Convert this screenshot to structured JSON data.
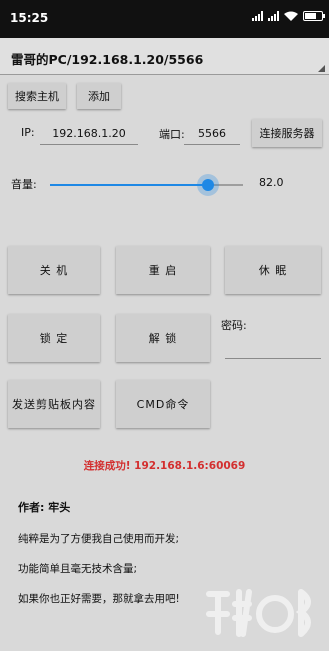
{
  "status_bar": {
    "time": "15:25",
    "icons": [
      "signal-icon",
      "wifi-icon",
      "battery-icon"
    ]
  },
  "server_select": {
    "selected": "雷哥的PC/192.168.1.20/5566"
  },
  "buttons": {
    "search_host": "搜索主机",
    "add": "添加",
    "connect_server": "连接服务器",
    "shutdown": "关 机",
    "restart": "重 启",
    "sleep": "休 眠",
    "lock": "锁 定",
    "unlock": "解 锁",
    "send_clipboard": "发送剪贴板内容",
    "cmd": "CMD命令"
  },
  "connection": {
    "ip_label": "IP:",
    "ip_value": "192.168.1.20",
    "port_label": "端口:",
    "port_value": "5566"
  },
  "volume": {
    "label": "音量:",
    "value": 82.0,
    "value_text": "82.0",
    "fraction": 0.82,
    "accent": "#1e88e5"
  },
  "password": {
    "label": "密码:",
    "value": ""
  },
  "status": {
    "message": "连接成功! 192.168.1.6:60069",
    "color": "#d32f2f"
  },
  "info": {
    "author": "作者: 牢头",
    "line1": "纯粹是为了方便我自己使用而开发;",
    "line2": "功能简单且毫无技术含量;",
    "line3": "如果你也正好需要，那就拿去用吧!"
  }
}
